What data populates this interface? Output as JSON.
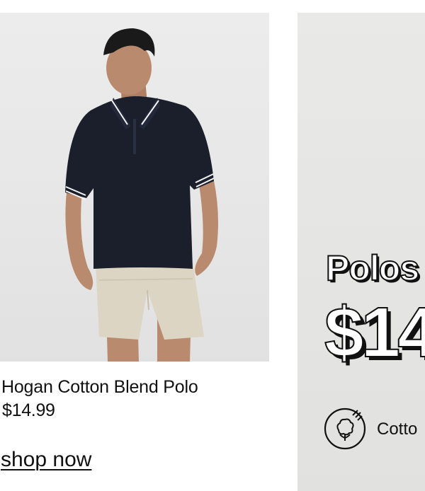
{
  "product": {
    "name": "Hogan Cotton Blend Polo",
    "price": "$14.99",
    "shop_link": "shop now",
    "image_alt": "Man wearing a navy polo shirt and beige shorts"
  },
  "promo": {
    "heading": "Polos",
    "price": "$14",
    "feature_icon": "cotton-icon",
    "feature_label": "Cotto"
  },
  "colors": {
    "shirt_navy": "#1b1f2b",
    "shorts_beige": "#ddd5c4",
    "background_gray": "#e8e8e8",
    "text": "#111111"
  }
}
